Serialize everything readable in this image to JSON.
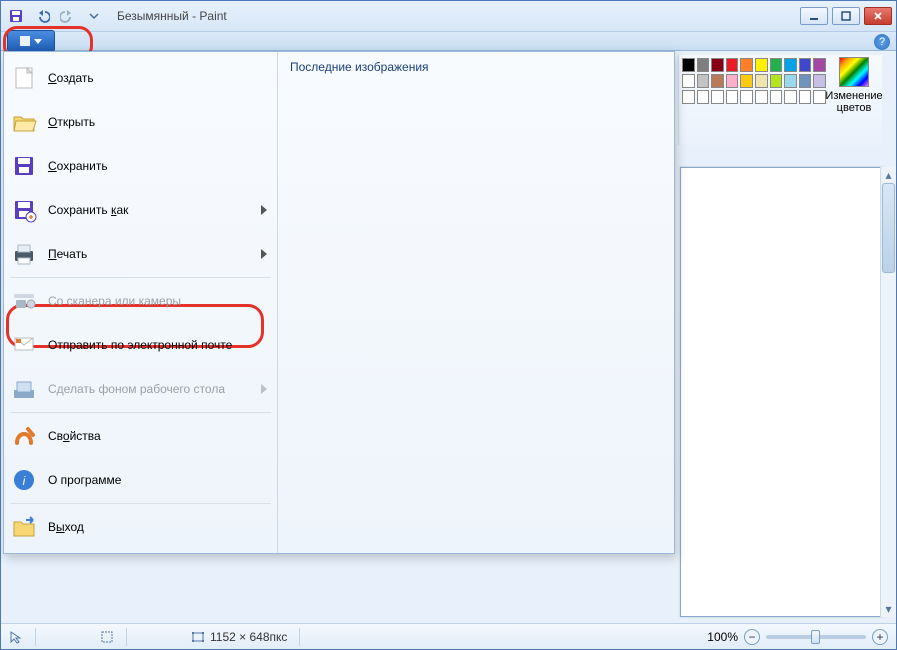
{
  "window_title": "Безымянный - Paint",
  "help_glyph": "?",
  "file_menu": {
    "recent_header": "Последние изображения",
    "items": [
      {
        "label": "Создать",
        "underline_index": 0
      },
      {
        "label": "Открыть",
        "underline_index": 0
      },
      {
        "label": "Сохранить",
        "underline_index": 0
      },
      {
        "label": "Сохранить как",
        "underline_index": 10,
        "has_submenu": true
      },
      {
        "label": "Печать",
        "underline_index": 0,
        "has_submenu": true
      },
      {
        "label": "Со сканера или камеры",
        "disabled": true
      },
      {
        "label": "Отправить по электронной почте"
      },
      {
        "label": "Сделать фоном рабочего стола",
        "has_submenu": true,
        "disabled": true
      },
      {
        "label": "Свойства",
        "underline_index": 2
      },
      {
        "label": "О программе"
      },
      {
        "label": "Выход",
        "underline_index": 1
      }
    ]
  },
  "colors_panel": {
    "edit_label": "Изменение цветов",
    "row1": [
      "#000000",
      "#7f7f7f",
      "#880015",
      "#ed1c24",
      "#ff7f27",
      "#fff200",
      "#22b14c",
      "#00a2e8",
      "#3f48cc",
      "#a349a4"
    ],
    "row2": [
      "#ffffff",
      "#c3c3c3",
      "#b97a57",
      "#ffaec9",
      "#ffc90e",
      "#efe4b0",
      "#b5e61d",
      "#99d9ea",
      "#7092be",
      "#c8bfe7"
    ],
    "row3": [
      "#ffffff",
      "#ffffff",
      "#ffffff",
      "#ffffff",
      "#ffffff",
      "#ffffff",
      "#ffffff",
      "#ffffff",
      "#ffffff",
      "#ffffff"
    ]
  },
  "status": {
    "canvas_size": "1152 × 648пкс",
    "zoom": "100%"
  },
  "window_buttons": {
    "min": "_",
    "max": "□",
    "close": "✕"
  }
}
